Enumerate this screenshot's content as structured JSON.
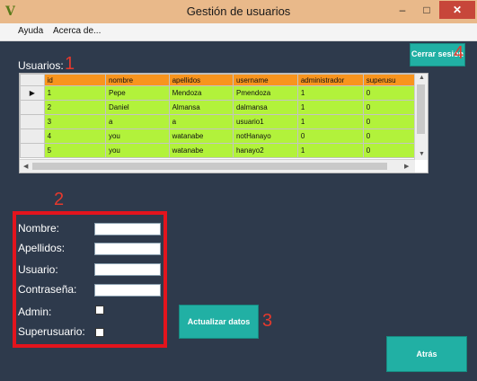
{
  "window": {
    "title": "Gestión de usuarios",
    "minimize": "–",
    "maximize": "□",
    "close": "✕",
    "app_icon": "V"
  },
  "menu": [
    "Ayuda",
    "Acerca de..."
  ],
  "annotations": [
    "1",
    "2",
    "3",
    "4"
  ],
  "usuarios_label": "Usuarios:",
  "logout_button": "Cerrar sesión",
  "grid": {
    "columns": [
      "id",
      "nombre",
      "apellidos",
      "username",
      "administrador",
      "superusu"
    ],
    "rows": [
      [
        "1",
        "Pepe",
        "Mendoza",
        "Pmendoza",
        "1",
        "0"
      ],
      [
        "2",
        "Daniel",
        "Almansa",
        "dalmansa",
        "1",
        "0"
      ],
      [
        "3",
        "a",
        "a",
        "usuario1",
        "1",
        "0"
      ],
      [
        "4",
        "you",
        "watanabe",
        "notHanayo",
        "0",
        "0"
      ],
      [
        "5",
        "you",
        "watanabe",
        "hanayo2",
        "1",
        "0"
      ]
    ],
    "current_row_marker": "▶"
  },
  "form": {
    "nombre_label": "Nombre:",
    "apellidos_label": "Apellidos:",
    "usuario_label": "Usuario:",
    "contrasena_label": "Contraseña:",
    "admin_label": "Admin:",
    "superusuario_label": "Superusuario:"
  },
  "update_button": "Actualizar datos",
  "back_button": "Atrás",
  "colors": {
    "background": "#2e3a4c",
    "teal": "#21b0a4",
    "header_orange": "#f8941d",
    "row_green": "#b2f23b",
    "annotation_red": "#e3141d"
  }
}
